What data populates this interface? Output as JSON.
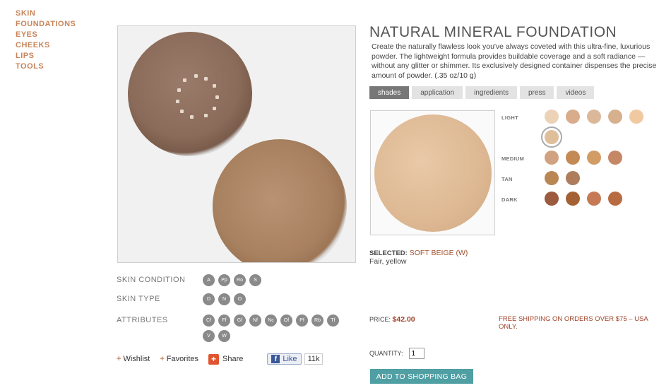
{
  "nav": [
    "SKIN",
    "FOUNDATIONS",
    "EYES",
    "CHEEKS",
    "LIPS",
    "TOOLS"
  ],
  "product": {
    "title": "NATURAL MINERAL FOUNDATION",
    "description": "Create the naturally flawless look you've always coveted with this ultra-fine, luxurious powder. The lightweight formula provides buildable coverage and a soft radiance — without any glitter or shimmer. Its exclusively designed container dispenses the precise amount of powder. (.35 oz/10 g)"
  },
  "tabs": [
    {
      "label": "shades",
      "active": true
    },
    {
      "label": "application",
      "active": false
    },
    {
      "label": "ingredients",
      "active": false
    },
    {
      "label": "press",
      "active": false
    },
    {
      "label": "videos",
      "active": false
    }
  ],
  "shade_groups": [
    {
      "label": "LIGHT",
      "colors": [
        "#ecd3b8",
        "#d9ac8c",
        "#dcb89a",
        "#d7b08e",
        "#f0c9a0"
      ],
      "selected_row2": [
        "#dfbe9a"
      ]
    },
    {
      "label": "MEDIUM",
      "colors": [
        "#d1a281",
        "#c48a56",
        "#d29c65",
        "#c58766"
      ]
    },
    {
      "label": "TAN",
      "colors": [
        "#b98753",
        "#ad7d5c"
      ]
    },
    {
      "label": "DARK",
      "colors": [
        "#9c5a3e",
        "#a46234",
        "#c57a55",
        "#b86b40"
      ]
    }
  ],
  "attributes": {
    "skin_condition_label": "SKIN CONDITION",
    "skin_condition": [
      "A",
      "Pp",
      "Ro",
      "S"
    ],
    "skin_type_label": "SKIN TYPE",
    "skin_type": [
      "D",
      "N",
      "O"
    ],
    "attributes_label": "ATTRIBUTES",
    "attributes": [
      "Cf",
      "Ff",
      "Gf",
      "Nf",
      "Nc",
      "Of",
      "Pf",
      "Rb",
      "Tf",
      "V",
      "W"
    ]
  },
  "actions": {
    "wishlist": "Wishlist",
    "favorites": "Favorites",
    "share": "Share",
    "like": "Like",
    "like_count": "11k"
  },
  "selection": {
    "label": "SELECTED:",
    "value": "SOFT BEIGE (W)",
    "sub": "Fair, yellow"
  },
  "price": {
    "label": "PRICE:",
    "amount": "$42.00"
  },
  "shipping": "FREE SHIPPING ON ORDERS OVER $75 – USA ONLY.",
  "quantity": {
    "label": "QUANTITY:",
    "value": "1"
  },
  "cart_button": "ADD TO SHOPPING BAG"
}
